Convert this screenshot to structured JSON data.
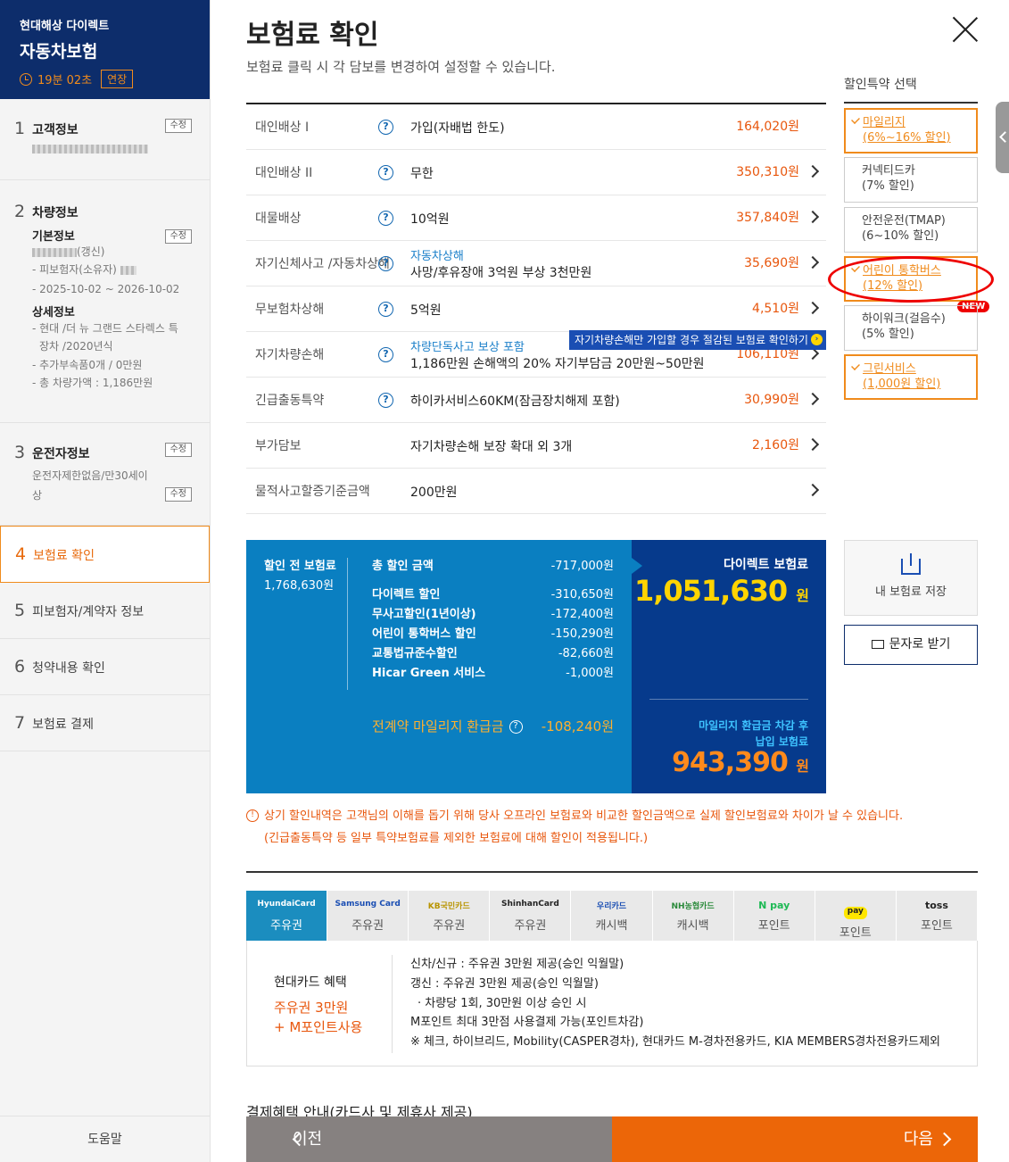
{
  "sidebar": {
    "company": "현대해상 다이렉트",
    "product": "자동차보험",
    "timer": "19분 02초",
    "extend_label": "연장",
    "edit_label": "수정",
    "steps": [
      {
        "num": "1",
        "label": "고객정보"
      },
      {
        "num": "2",
        "label": "차량정보",
        "basic_title": "기본정보",
        "basic_suffix": "(갱신)",
        "basic_lines": [
          "- 피보험자(소유자)",
          "- 2025-10-02 ~ 2026-10-02"
        ],
        "detail_title": "상세정보",
        "detail_lines": [
          "- 현대 /더 뉴 그랜드 스타렉스 특",
          "장차 /2020년식",
          "- 추가부속품0개 / 0만원",
          "- 총 차량가액 : 1,186만원"
        ]
      },
      {
        "num": "3",
        "label": "운전자정보",
        "lines": [
          "운전자제한없음/만30세이",
          "상"
        ]
      },
      {
        "num": "4",
        "label": "보험료 확인"
      },
      {
        "num": "5",
        "label": "피보험자/계약자 정보"
      },
      {
        "num": "6",
        "label": "청약내용 확인"
      },
      {
        "num": "7",
        "label": "보험료 결제"
      }
    ],
    "help": "도움말"
  },
  "header": {
    "title": "보험료 확인",
    "subtitle": "보험료 클릭 시 각 담보를 변경하여 설정할 수 있습니다."
  },
  "coverages": [
    {
      "name": "대인배상 I",
      "value": "가입(자배법 한도)",
      "amount": "164,020원"
    },
    {
      "name": "대인배상 II",
      "value": "무한",
      "amount": "350,310원"
    },
    {
      "name": "대물배상",
      "value": "10억원",
      "amount": "357,840원"
    },
    {
      "name1": "자기신체사고 /",
      "name2": "자동차상해",
      "sub": "자동차상해",
      "value": "사망/후유장애 3억원 부상 3천만원",
      "amount": "35,690원"
    },
    {
      "name": "무보험차상해",
      "value": "5억원",
      "amount": "4,510원"
    },
    {
      "name": "자기차량손해",
      "sub": "차량단독사고 보상 포함",
      "value": "1,186만원 손해액의 20% 자기부담금 20만원~50만원",
      "amount": "106,110원"
    },
    {
      "name": "긴급출동특약",
      "value": "하이카서비스60KM(잠금장치해제 포함)",
      "amount": "30,990원"
    },
    {
      "name": "부가담보",
      "value": "자기차량손해 보장 확대 외 3개",
      "amount": "2,160원"
    },
    {
      "name": "물적사고할증기준금액",
      "value": "200만원",
      "amount": ""
    }
  ],
  "tip_banner": "자기차량손해만 가입할 경우 절감된 보험료 확인하기",
  "discount_panel": {
    "title": "할인특약 선택",
    "items": [
      {
        "line1": "마일리지",
        "line2": "(6%~16% 할인)",
        "selected": true
      },
      {
        "line1": "커넥티드카",
        "line2": "(7% 할인)",
        "selected": false
      },
      {
        "line1": "안전운전(TMAP)",
        "line2": "(6~10% 할인)",
        "selected": false
      },
      {
        "line1": "어린이 통학버스",
        "line2": "(12% 할인)",
        "selected": true
      },
      {
        "line1": "하이워크(걸음수)",
        "line2": "(5% 할인)",
        "selected": false
      },
      {
        "line1": "그린서비스",
        "line2": "(1,000원 할인)",
        "selected": true
      }
    ],
    "new_badge": "NEW"
  },
  "summary": {
    "pre_label": "할인 전 보험료",
    "pre_amount": "1,768,630원",
    "total_label": "총 할인 금액",
    "total_amount": "-717,000원",
    "discounts": [
      {
        "label": "다이렉트 할인",
        "amount": "-310,650원"
      },
      {
        "label": "무사고할인(1년이상)",
        "amount": "-172,400원"
      },
      {
        "label": "어린이 통학버스 할인",
        "amount": "-150,290원"
      },
      {
        "label": "교통법규준수할인",
        "amount": "-82,660원"
      },
      {
        "label": "Hicar Green 서비스",
        "amount": "-1,000원"
      }
    ],
    "mileage_label": "전계약 마일리지 환급금",
    "mileage_amount": "-108,240원",
    "direct_label": "다이렉트 보험료",
    "direct_amount": "1,051,630",
    "won": "원",
    "after_label1": "마일리지 환급금 차감 후",
    "after_label2": "납입 보험료",
    "after_amount": "943,390"
  },
  "actions": {
    "save_label": "내 보험료 저장",
    "sms_label": "문자로 받기"
  },
  "notice": {
    "line1": "상기 할인내역은 고객님의 이해를 돕기 위해 당사 오프라인 보험료와 비교한 할인금액으로 실제 할인보험료와 차이가 날 수 있습니다.",
    "line2": "(긴급출동특약 등 일부 특약보험료를 제외한 보험료에 대해 할인이 적용됩니다.)"
  },
  "card_tabs": [
    {
      "brand": "HyundaiCard",
      "kind": "주유권",
      "active": true
    },
    {
      "brand": "Samsung Card",
      "kind": "주유권"
    },
    {
      "brand": "KB국민카드",
      "kind": "주유권"
    },
    {
      "brand": "ShinhanCard",
      "kind": "주유권"
    },
    {
      "brand": "우리카드",
      "kind": "캐시백"
    },
    {
      "brand": "NH농협카드",
      "kind": "캐시백"
    },
    {
      "brand": "N pay",
      "kind": "포인트"
    },
    {
      "brand": "pay",
      "kind": "포인트"
    },
    {
      "brand": "toss",
      "kind": "포인트"
    }
  ],
  "card_panel": {
    "name": "현대카드 혜택",
    "benefit1": "주유권 3만원",
    "benefit2": "+ M포인트사용",
    "lines": [
      "신차/신규 : 주유권 3만원 제공(승인 익월말)",
      "갱신 : 주유권 3만원 제공(승인 익월말)",
      "· 차량당 1회, 30만원 이상 승인 시",
      "M포인트 최대 3만점 사용결제 가능(포인트차감)",
      "※ 체크, 하이브리드, Mobility(CASPER경차), 현대카드 M-경차전용카드, KIA MEMBERS경차전용카드제외"
    ]
  },
  "pay_title": "결제혜택 안내(카드사 및 제휴사 제공)",
  "nav": {
    "prev": "이전",
    "next": "다음"
  }
}
